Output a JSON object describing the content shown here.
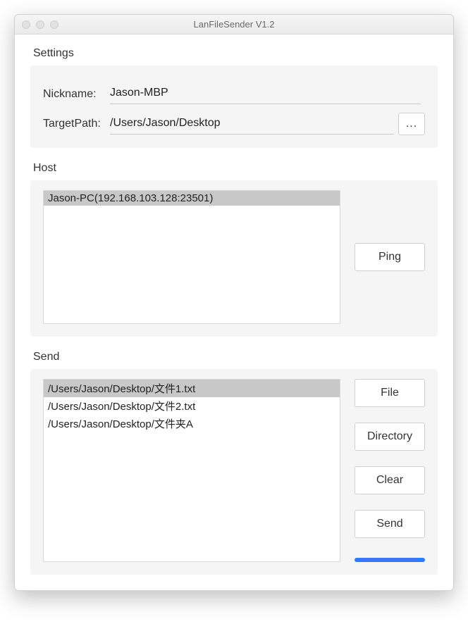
{
  "window": {
    "title": "LanFileSender V1.2"
  },
  "settings": {
    "panel_label": "Settings",
    "nickname_label": "Nickname:",
    "nickname_value": "Jason-MBP",
    "targetpath_label": "TargetPath:",
    "targetpath_value": "/Users/Jason/Desktop",
    "browse_label": "..."
  },
  "host": {
    "panel_label": "Host",
    "items": [
      "Jason-PC(192.168.103.128:23501)"
    ],
    "selected_index": 0,
    "ping_label": "Ping"
  },
  "send": {
    "panel_label": "Send",
    "items": [
      "/Users/Jason/Desktop/文件1.txt",
      "/Users/Jason/Desktop/文件2.txt",
      "/Users/Jason/Desktop/文件夹A"
    ],
    "selected_index": 0,
    "file_label": "File",
    "directory_label": "Directory",
    "clear_label": "Clear",
    "send_label": "Send",
    "progress_percent": 100
  }
}
